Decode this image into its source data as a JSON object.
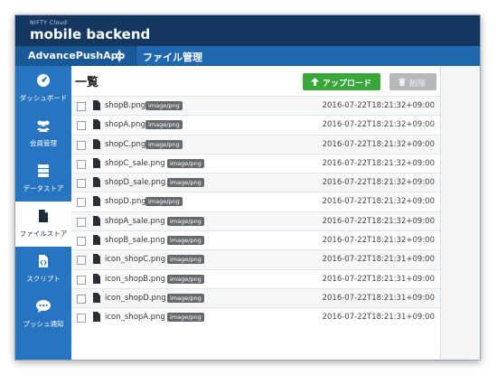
{
  "header": {
    "brand_small": "NIFTY Cloud",
    "brand": "mobile backend",
    "app_name": "AdvancePushApp",
    "page_name": "ファイル管理"
  },
  "sidebar": {
    "items": [
      {
        "label": "ダッシュボード",
        "icon": "dashboard-icon",
        "active": false
      },
      {
        "label": "会員管理",
        "icon": "users-icon",
        "active": false
      },
      {
        "label": "データストア",
        "icon": "database-icon",
        "active": false
      },
      {
        "label": "ファイルストア",
        "icon": "file-icon",
        "active": true
      },
      {
        "label": "スクリプト",
        "icon": "script-icon",
        "active": false
      },
      {
        "label": "プッシュ通知",
        "icon": "push-notification-icon",
        "active": false
      }
    ]
  },
  "main": {
    "title": "一覧",
    "upload_label": "アップロード",
    "delete_label": "削除"
  },
  "files": [
    {
      "name": "shopB.png",
      "type": "image/png",
      "timestamp": "2016-07-22T18:21:32+09:00"
    },
    {
      "name": "shopA.png",
      "type": "image/png",
      "timestamp": "2016-07-22T18:21:32+09:00"
    },
    {
      "name": "shopC.png",
      "type": "image/png",
      "timestamp": "2016-07-22T18:21:32+09:00"
    },
    {
      "name": "shopC_sale.png",
      "type": "image/png",
      "timestamp": "2016-07-22T18:21:32+09:00"
    },
    {
      "name": "shopD_sale.png",
      "type": "image/png",
      "timestamp": "2016-07-22T18:21:32+09:00"
    },
    {
      "name": "shopD.png",
      "type": "image/png",
      "timestamp": "2016-07-22T18:21:32+09:00"
    },
    {
      "name": "shopA_sale.png",
      "type": "image/png",
      "timestamp": "2016-07-22T18:21:32+09:00"
    },
    {
      "name": "shopB_sale.png",
      "type": "image/png",
      "timestamp": "2016-07-22T18:21:32+09:00"
    },
    {
      "name": "icon_shopC.png",
      "type": "image/png",
      "timestamp": "2016-07-22T18:21:31+09:00"
    },
    {
      "name": "icon_shopB.png",
      "type": "image/png",
      "timestamp": "2016-07-22T18:21:31+09:00"
    },
    {
      "name": "icon_shopD.png",
      "type": "image/png",
      "timestamp": "2016-07-22T18:21:31+09:00"
    },
    {
      "name": "icon_shopA.png",
      "type": "image/png",
      "timestamp": "2016-07-22T18:21:31+09:00"
    }
  ],
  "colors": {
    "topbar": "#14375f",
    "appbar": "#1f68b0",
    "sidebar": "#2775c1",
    "upload": "#39a63a",
    "delete_disabled": "#b6b9bc"
  }
}
